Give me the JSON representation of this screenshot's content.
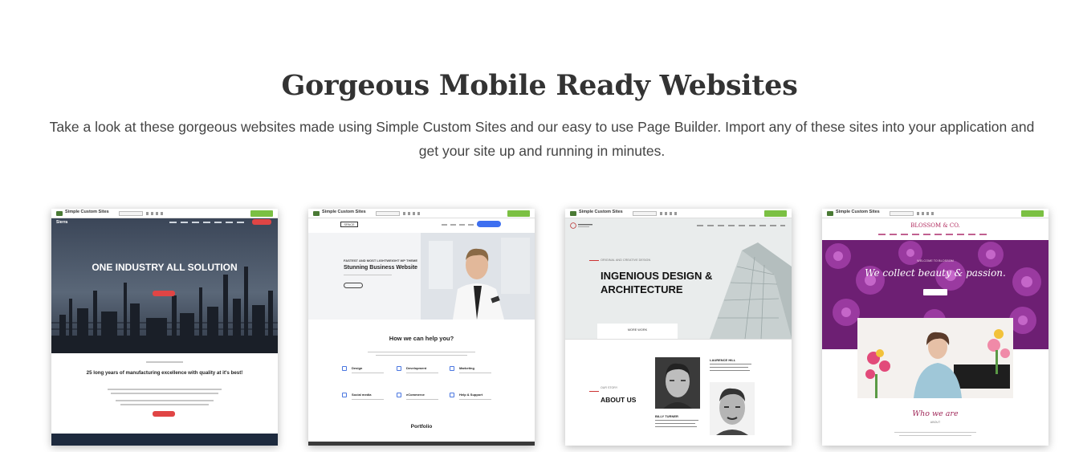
{
  "section": {
    "title": "Gorgeous Mobile Ready Websites",
    "description": "Take a look at these gorgeous websites made using Simple Custom Sites and our easy to use Page Builder. Import any of these sites into your application and get your site up and running in minutes."
  },
  "builder_bar": {
    "name": "Simple Custom Sites"
  },
  "templates": [
    {
      "hero_title": "ONE INDUSTRY ALL SOLUTION",
      "section_title": "25 long years of manufacturing excellence with quality at it's best!"
    },
    {
      "logo": "SPACE",
      "kicker": "FASTEST AND MOST LIGHTWEIGHT WP THEME",
      "hero_title": "Stunning Business Website",
      "help_title": "How we can help you?",
      "services": [
        "Design",
        "Development",
        "Marketing",
        "Social media",
        "eCommerce",
        "Help & Support"
      ],
      "portfolio_title": "Portfolio"
    },
    {
      "kicker": "ORIGINAL AND CREATIVE DESIGN",
      "hero_title_1": "INGENIOUS DESIGN &",
      "hero_title_2": "ARCHITECTURE",
      "more_label": "MORE WORK",
      "about_kicker": "OUR STORY",
      "about_title": "ABOUT US",
      "person_1": "LAURENCE HILL",
      "person_2": "BILLY TURNER"
    },
    {
      "brand": "BLOSSOM & CO.",
      "kicker": "WELCOME TO BLOSSOM",
      "hero_title": "We collect beauty & passion.",
      "who_title": "Who we are",
      "about_small": "ABOUT"
    }
  ],
  "colors": {
    "accent_red": "#e04545",
    "accent_blue": "#3d6ff0",
    "accent_green": "#7bc043",
    "blossom_pink": "#a02859"
  }
}
